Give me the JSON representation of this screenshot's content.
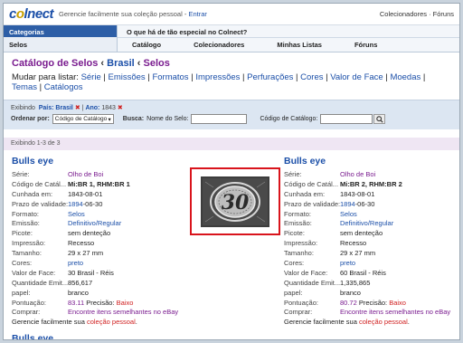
{
  "topbar": {
    "logo_prefix": "c",
    "logo_o": "o",
    "logo_suffix": "lnect",
    "tagline": "Gerencie facilmente sua coleção pessoal - ",
    "tagline_link": "Entrar",
    "right_links": "Colecionadores · Fóruns"
  },
  "menu": {
    "categories_head": "Categorias",
    "selected_category": "Selos",
    "question": "O que há de tão especial no Colnect?",
    "links": [
      "Catálogo",
      "Colecionadores",
      "Minhas Listas",
      "Fóruns"
    ]
  },
  "breadcrumb": {
    "part1": "Catálogo de Selos",
    "sep": " ‹ ",
    "part2": "Brasil",
    "part3": "Selos"
  },
  "viewlist": {
    "label": "Mudar para listar: ",
    "items": [
      "Série",
      "Emissões",
      "Formatos",
      "Impressões",
      "Perfurações",
      "Cores",
      "Valor de Face",
      "Moedas",
      "Temas",
      "Catálogos"
    ]
  },
  "filters": {
    "showing": "Exibindo",
    "country_label": "País: Brasil",
    "year_label": "Ano:",
    "year_value": "1843",
    "sort_label": "Ordenar por:",
    "sort_value": "Código de Catálogo",
    "search_label": "Busca:",
    "search_placeholder": "Nome do Selo:",
    "catalog_label": "Código de Catálogo:"
  },
  "counter": "Exibindo  1-3 de 3",
  "stamps": [
    {
      "title": "Bulls eye",
      "serie": "Olho de Boi",
      "codigo_k": "Código de Catál...",
      "codigo_v": "Mi:BR 1, RHM:BR 1",
      "cunhada": "1843-08-01",
      "prazo_year": "1894",
      "prazo_rest": "-06-30",
      "formato": "Selos",
      "emissao": "Definitivo/Regular",
      "picote": "sem denteção",
      "impressao": "Recesso",
      "tamanho": "29 x 27 mm",
      "cores": "preto",
      "valor": "30 Brasil - Réis",
      "quantidade_k": "Quantidade Emit...",
      "quantidade": "856,617",
      "papel": "branco",
      "pontuacao": "83.11",
      "precisao_label": " Precisão: ",
      "precisao": "Baixo",
      "comprar": "Encontre itens semelhantes no eBay",
      "foot": "Gerencie facilmente sua ",
      "foot_link": "coleção pessoal",
      "foot_end": "."
    },
    {
      "title": "Bulls eye",
      "serie": "Olho de Boi",
      "codigo_k": "Código de Catál...",
      "codigo_v": "Mi:BR 2, RHM:BR 2",
      "cunhada": "1843-08-01",
      "prazo_year": "1894",
      "prazo_rest": "-06-30",
      "formato": "Selos",
      "emissao": "Definitivo/Regular",
      "picote": "sem denteção",
      "impressao": "Recesso",
      "tamanho": "29 x 27 mm",
      "cores": "preto",
      "valor": "60 Brasil - Réis",
      "quantidade_k": "Quantidade Emit...",
      "quantidade": "1,335,865",
      "papel": "branco",
      "pontuacao": "80.72",
      "precisao_label": " Precisão: ",
      "precisao": "Baixo",
      "comprar": "Encontre itens semelhantes no eBay",
      "foot": "Gerencie facilmente sua ",
      "foot_link": "coleção pessoal",
      "foot_end": "."
    }
  ],
  "labels": {
    "serie": "Série:",
    "cunhada": "Cunhada em:",
    "prazo": "Prazo de validade:",
    "formato": "Formato:",
    "emissao": "Emissão:",
    "picote": "Picote:",
    "impressao": "Impressão:",
    "tamanho": "Tamanho:",
    "cores": "Cores:",
    "valor": "Valor de Face:",
    "papel": "papel:",
    "pontuacao": "Pontuação:",
    "comprar": "Comprar:"
  },
  "stamp_image": {
    "numeral": "30"
  },
  "next_title": "Bulls eye",
  "colors": {
    "link": "#1b4fa8",
    "accent_purple": "#7a1c8f",
    "warning_red": "#d02020",
    "highlight_border": "#d9141c"
  }
}
